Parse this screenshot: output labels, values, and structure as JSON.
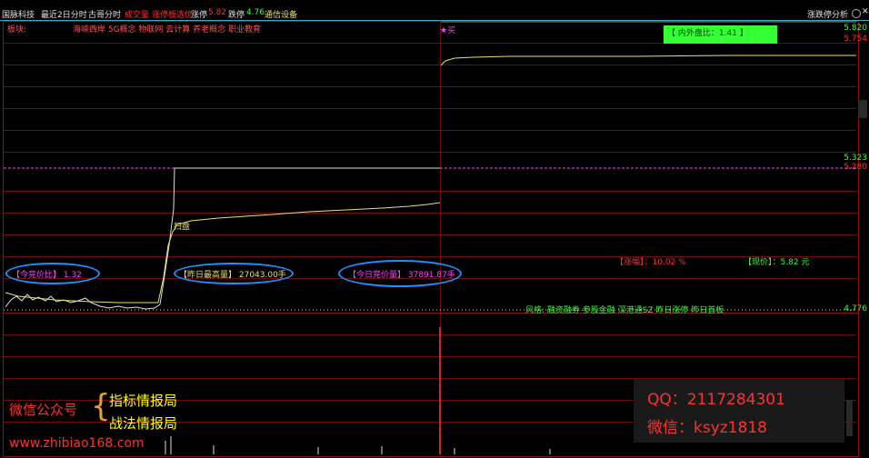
{
  "topbar": {
    "stock": "国脉科技",
    "tabs": [
      "最近2日分时",
      "古哥分时",
      "成交量",
      "涨停板选优"
    ],
    "limit_up_label": "涨停",
    "limit_up_val": "5.82",
    "limit_down_label": "跌停",
    "limit_down_val": "4.76",
    "industry": "通信设备",
    "right_title": "涨跌停分析"
  },
  "plate": {
    "label": "板块:",
    "value": "海峡西岸 5G概念 物联网 云计算 养老概念 职业教育"
  },
  "chart": {
    "buy_marker": "★买",
    "scan_marker": "扫盘",
    "inout_box": "【 内外盘比：1.41 】",
    "prices": [
      "5.820",
      "5.754",
      "5.323",
      "5.280",
      "4.776"
    ],
    "labels": {
      "today_auction_ratio": "【今竞价比】  1.32",
      "yesterday_max": "【昨日最高量】  27043.00手",
      "today_auction_vol": "【今日竞价量】  37891.87手",
      "change": "【涨幅】：10.02 %",
      "price": "【现价】：5.82 元",
      "concept": "风格:    融资融券 参股金融 深港通SZ 昨日涨停 昨日首板"
    },
    "colors": {
      "accent_red": "#ff3030",
      "grid_red": "#6b0d0d",
      "line_yellow": "#e8e070",
      "line_white": "#e0e0e0",
      "magenta": "#ff40ff",
      "ellipse": "#1e90ff",
      "green_box": "#33ff33"
    }
  },
  "watermark": {
    "left_title": "微信公众号",
    "left_item1": "指标情报局",
    "left_item2": "战法情报局",
    "url": "www.zhibiao168.com",
    "qq": "QQ：2117284301",
    "wechat": "微信：ksyz1818"
  },
  "toolbar": {
    "settings_icon": "gear-icon",
    "close_icon": "close-icon"
  }
}
